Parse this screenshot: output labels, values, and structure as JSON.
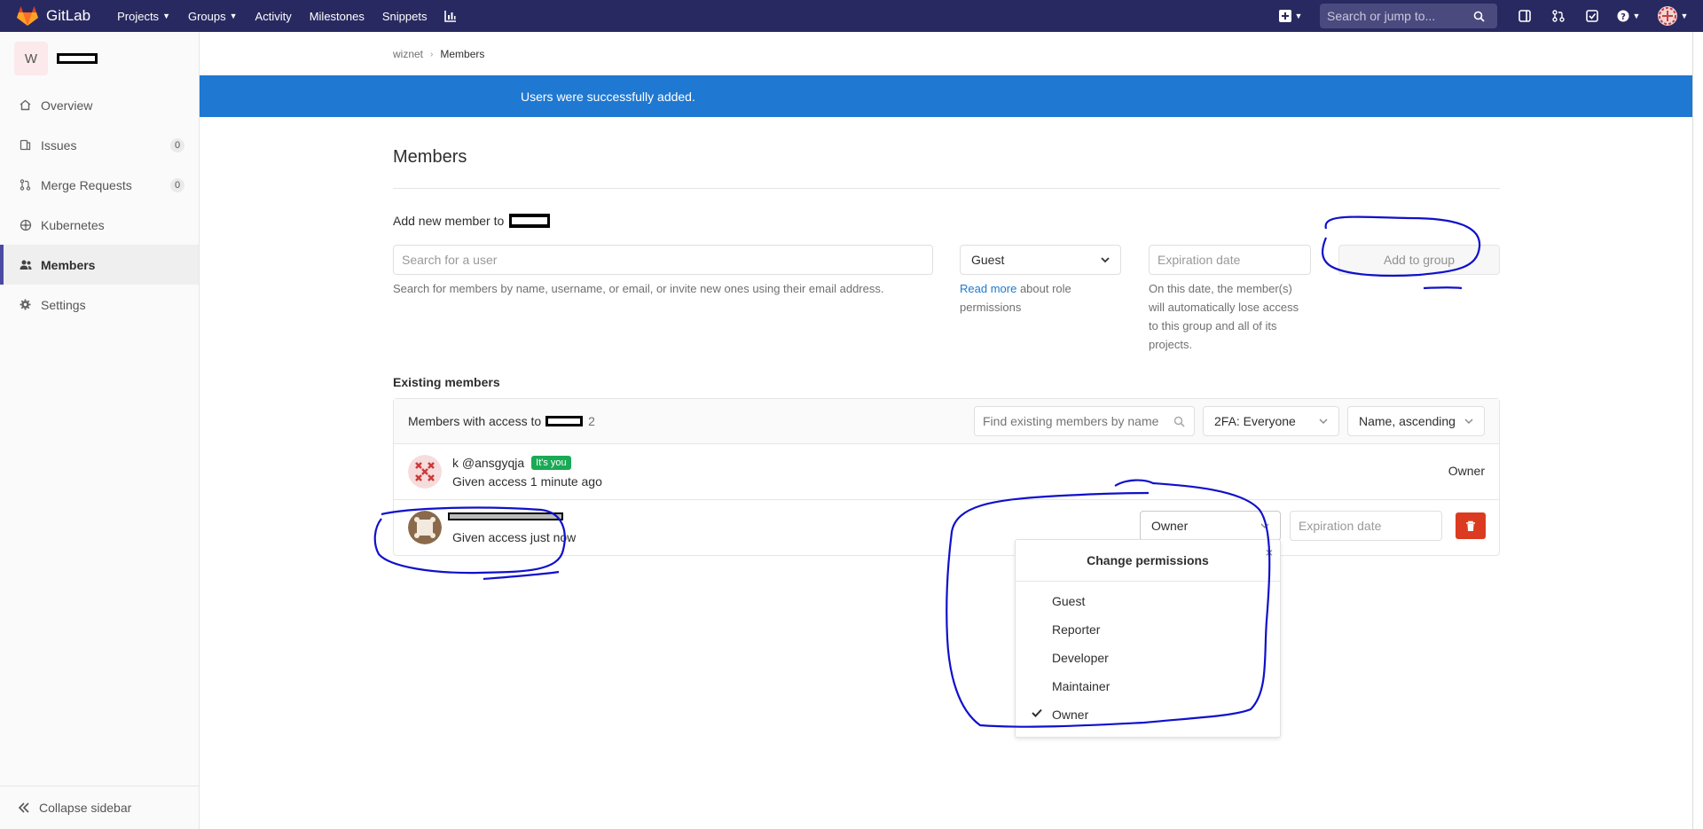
{
  "navbar": {
    "brand": "GitLab",
    "links": [
      "Projects",
      "Groups",
      "Activity",
      "Milestones",
      "Snippets"
    ],
    "search_placeholder": "Search or jump to...",
    "bg_color": "#292961"
  },
  "sidebar": {
    "group_initial": "W",
    "items": [
      {
        "label": "Overview",
        "icon": "home-icon"
      },
      {
        "label": "Issues",
        "icon": "issues-icon",
        "count": "0"
      },
      {
        "label": "Merge Requests",
        "icon": "merge-request-icon",
        "count": "0"
      },
      {
        "label": "Kubernetes",
        "icon": "kubernetes-icon"
      },
      {
        "label": "Members",
        "icon": "users-icon",
        "active": true
      },
      {
        "label": "Settings",
        "icon": "gear-icon"
      }
    ],
    "collapse_label": "Collapse sidebar"
  },
  "breadcrumb": {
    "parent": "wiznet",
    "current": "Members"
  },
  "flash": {
    "message": "Users were successfully added.",
    "color": "#1f78d1"
  },
  "page_title": "Members",
  "add_member": {
    "label": "Add new member to",
    "search_placeholder": "Search for a user",
    "search_help": "Search for members by name, username, or email, or invite new ones using their email address.",
    "role_selected": "Guest",
    "role_help_link": "Read more",
    "role_help_text": "about role",
    "role_help_text2": "permissions",
    "expiration_placeholder": "Expiration date",
    "expiration_help": [
      "On this date, the member(s)",
      "will automatically lose access",
      "to this group and all of its",
      "projects."
    ],
    "add_button": "Add to group"
  },
  "existing": {
    "label": "Existing members",
    "header_prefix": "Members with access to",
    "count": "2",
    "filter_placeholder": "Find existing members by name",
    "twofa_filter": "2FA: Everyone",
    "sort": "Name, ascending",
    "members": [
      {
        "name": "k @ansgyqja",
        "badge": "It's you",
        "access": "Given access 1 minute ago",
        "role": "Owner"
      },
      {
        "access": "Given access just now",
        "role": "Owner",
        "expiration_placeholder": "Expiration date"
      }
    ]
  },
  "permissions_dropdown": {
    "title": "Change permissions",
    "options": [
      "Guest",
      "Reporter",
      "Developer",
      "Maintainer",
      "Owner"
    ],
    "selected": "Owner"
  },
  "colors": {
    "danger": "#db3b21",
    "success": "#1aaa55",
    "annotation": "#0000cc",
    "link": "#1f78d1"
  }
}
